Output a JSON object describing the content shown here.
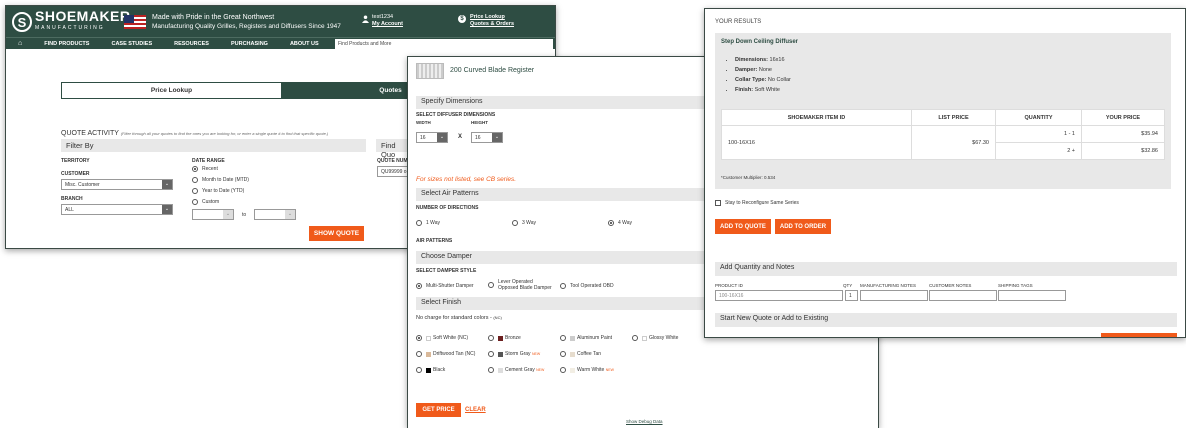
{
  "panel1": {
    "logo": {
      "letter": "S",
      "name": "SHOEMAKER",
      "tagline": "MANUFACTURING"
    },
    "pride_line1": "Made with Pride in the Great Northwest",
    "pride_line2": "Manufacturing Quality Grilles, Registers and Diffusers Since 1947",
    "user": "test1234",
    "my_account": "My Account",
    "price_lookup": "Price Lookup",
    "quotes_orders": "Quotes & Orders",
    "nav": [
      "FIND PRODUCTS",
      "CASE STUDIES",
      "RESOURCES",
      "PURCHASING",
      "ABOUT US"
    ],
    "search_placeholder": "Find Products and More",
    "tab_price": "Price Lookup",
    "tab_quotes": "Quotes",
    "quote_activity": "QUOTE ACTIVITY",
    "quote_activity_hint": "(Filter through all your quotes to find the ones you are looking for, or enter a single quote # to find that specific quote.)",
    "filter_by": "Filter By",
    "find_quote": "Find Quo",
    "territory": "TERRITORY",
    "customer_label": "CUSTOMER",
    "customer_value": "Misc. Customer",
    "branch_label": "BRANCH",
    "branch_value": "ALL",
    "date_range": "DATE RANGE",
    "date_options": [
      "Recent",
      "Month to Date (MTD)",
      "Year to Date (YTD)",
      "Custom"
    ],
    "to": "to",
    "quote_number_label": "QUOTE NUMB",
    "quote_number_value": "QU99999 o",
    "show_quote": "SHOW QUOTE"
  },
  "panel2": {
    "product": "200 Curved Blade Register",
    "specify": "Specify Dimensions",
    "select_dims": "SELECT DIFFUSER DIMENSIONS",
    "width_label": "WIDTH",
    "height_label": "HEIGHT",
    "width": "16",
    "height": "16",
    "x": "X",
    "sizes_note": "For sizes not listed, see CB series.",
    "air_patterns": "Select Air Patterns",
    "num_directions": "NUMBER OF DIRECTIONS",
    "ways": [
      "1 Way",
      "3 Way",
      "4 Way"
    ],
    "air_patterns_label": "AIR PATTERNS",
    "damper": "Choose Damper",
    "damper_style": "SELECT DAMPER STYLE",
    "damper_opts": [
      "Multi-Shutter Damper",
      "Lever Operated",
      "Opposed Blade Damper",
      "Tool Operated OBD"
    ],
    "finish": "Select Finish",
    "no_charge": "No charge for standard colors - ",
    "nc": "(NC)",
    "finishes": [
      "Soft White (NC)",
      "Bronze",
      "Aluminum Paint",
      "Glossy White",
      "Driftwood Tan (NC)",
      "Storm Gray",
      "Coffee Tan",
      "Black",
      "Cement Gray",
      "Warm White"
    ],
    "new": "NEW",
    "get_price": "GET PRICE",
    "clear": "CLEAR",
    "debug": "Show Debug Data"
  },
  "panel3": {
    "your_results": "YOUR RESULTS",
    "item_title": "Step Down Ceiling Diffuser",
    "specs": [
      {
        "k": "Dimensions:",
        "v": "16x16"
      },
      {
        "k": "Damper:",
        "v": "None"
      },
      {
        "k": "Collar Type:",
        "v": "No Collar"
      },
      {
        "k": "Finish:",
        "v": "Soft White"
      }
    ],
    "headers": [
      "SHOEMAKER ITEM ID",
      "LIST PRICE",
      "QUANTITY",
      "YOUR PRICE"
    ],
    "item_id": "100-16X16",
    "list_price": "$67.30",
    "qty1": "1 - 1",
    "price1": "$35.94",
    "qty2": "2 +",
    "price2": "$32.86",
    "multiplier": "*Customer Multiplier: 0.534",
    "stay": "Stay to Reconfigure Same Series",
    "add_quote": "ADD TO QUOTE",
    "add_order": "ADD TO ORDER",
    "add_qty": "Add Quantity and Notes",
    "cols": [
      "PRODUCT ID",
      "QTY",
      "MANUFACTURING NOTES",
      "CUSTOMER NOTES",
      "SHIPPING TAGS"
    ],
    "prod_id_val": "100-16X16",
    "qty_val": "1",
    "start_new": "Start New Quote or Add to Existing"
  },
  "colors": {
    "brand": "#2e4d43",
    "accent": "#f05a1a"
  }
}
